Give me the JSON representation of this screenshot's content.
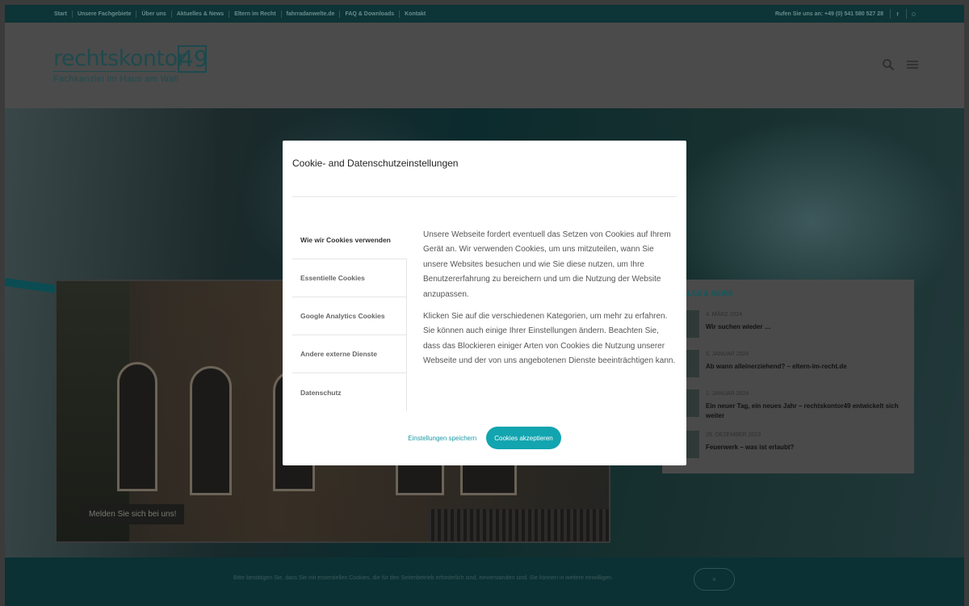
{
  "topbar": {
    "nav": [
      "Start",
      "Unsere Fachgebiete",
      "Über uns",
      "Aktuelles & News",
      "Eltern im Recht",
      "fahrradanwelte.de",
      "FAQ & Downloads",
      "Kontakt"
    ],
    "phone": "Rufen Sie uns an: +49 (0) 541 580 527 28",
    "social": [
      "facebook-icon",
      "whatsapp-icon"
    ]
  },
  "header": {
    "logo_main": "rechtskontor",
    "logo_number": "49",
    "logo_sub": "Fachkanzlei im Haus am Wall"
  },
  "hero": {
    "signup_label": "Melden Sie sich bei uns!"
  },
  "news": {
    "heading": "ELLES & NEWS",
    "items": [
      {
        "date": "4. MÄRZ 2024",
        "title": "Wir suchen wieder …"
      },
      {
        "date": "5. JANUAR 2024",
        "title": "Ab wann alleinerziehend? – eltern-im-recht.de"
      },
      {
        "date": "1. JANUAR 2024",
        "title": "Ein neuer Tag, ein neues Jahr – rechtskontor49 entwickelt sich weiter"
      },
      {
        "date": "29. DEZEMBER 2023",
        "title": "Feuerwerk – was ist erlaubt?"
      }
    ]
  },
  "cookiebar": {
    "text": "Bitte bestätigen Sie, dass Sie mit essentiellen Cookies, die für den Seitenbetrieb erforderlich sind, einverstanden sind. Sie können in weitere einwilligen.",
    "button": "×"
  },
  "modal": {
    "title": "Cookie- and Datenschutzeinstellungen",
    "tabs": [
      "Wie wir Cookies verwenden",
      "Essentielle Cookies",
      "Google Analytics Cookies",
      "Andere externe Dienste",
      "Datenschutz"
    ],
    "active_tab": 0,
    "paragraphs": [
      "Unsere Webseite fordert eventuell das Setzen von Cookies auf Ihrem Gerät an. Wir verwenden Cookies, um uns mitzuteilen, wann Sie unsere Websites besuchen und wie Sie diese nutzen, um Ihre Benutzererfahrung zu bereichern und um die Nutzung der Website anzupassen.",
      "Klicken Sie auf die verschiedenen Kategorien, um mehr zu erfahren. Sie können auch einige Ihrer Einstellungen ändern. Beachten Sie, dass das Blockieren einiger Arten von Cookies die Nutzung unserer Webseite und der von uns angebotenen Dienste beeinträchtigen kann."
    ],
    "save_label": "Einstellungen speichern",
    "accept_label": "Cookies akzeptieren",
    "accent_color": "#12a5b0"
  }
}
